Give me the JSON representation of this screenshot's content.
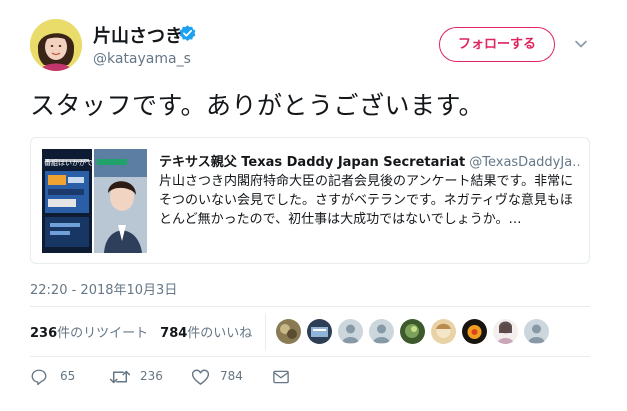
{
  "user": {
    "display_name": "片山さつき",
    "handle": "@katayama_s",
    "verified_icon": "verified-badge-icon",
    "avatar_icon": "profile-photo"
  },
  "follow_button": {
    "label": "フォローする",
    "color": "#e0245e"
  },
  "menu_icon": "chevron-down-icon",
  "tweet": {
    "text": "スタッフです。ありがとうございます。",
    "timestamp": "22:20 - 2018年10月3日"
  },
  "quote": {
    "author": "テキサス親父 Texas Daddy Japan Secretariat",
    "handle": "@TexasDaddyJa…",
    "body": "片山さつき内閣府特命大臣の記者会見後のアンケート結果です。非常にそつのいない会見でした。さすがベテランです。ネガティヴな意見もほとんど無かったので、初仕事は大成功ではないでしょうか。…",
    "media_overlay_text": "番組はいかがで"
  },
  "stats": {
    "retweets_count": "236",
    "retweets_label": "件のリツイート",
    "likes_count": "784",
    "likes_label": "件のいいね"
  },
  "actions": {
    "reply_count": "65",
    "retweet_count": "236",
    "like_count": "784"
  },
  "colors": {
    "accent": "#1da1f2",
    "muted_text": "#657786",
    "border": "#e6ecf0"
  }
}
